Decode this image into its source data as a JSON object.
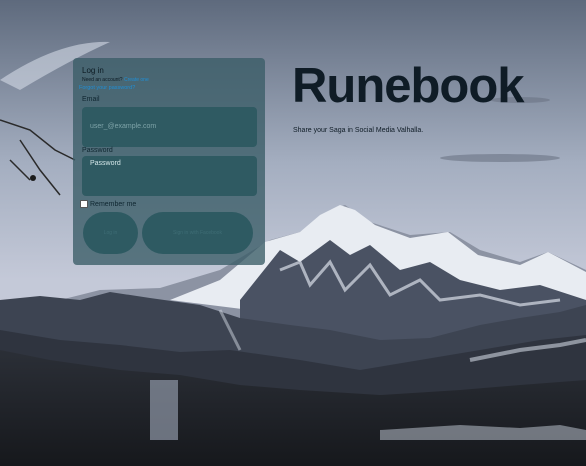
{
  "login": {
    "title": "Log in",
    "no_account_prefix": "Need an account?",
    "signup_link": "Create one",
    "forgot_link": "Forgot your password?",
    "email_label": "Email",
    "email_placeholder": "user_@example.com",
    "password_label": "Password",
    "password_placeholder": "Password",
    "remember_label": "Remember me",
    "login_button": "Log in",
    "register_button": "Sign in with Facebook"
  },
  "brand": {
    "name": "Runebook",
    "tagline": "Share your Saga in Social Media Valhalla."
  },
  "colors": {
    "card": "#3a5c66",
    "link": "#1f8fd6",
    "brand_text": "#0f1c26"
  }
}
